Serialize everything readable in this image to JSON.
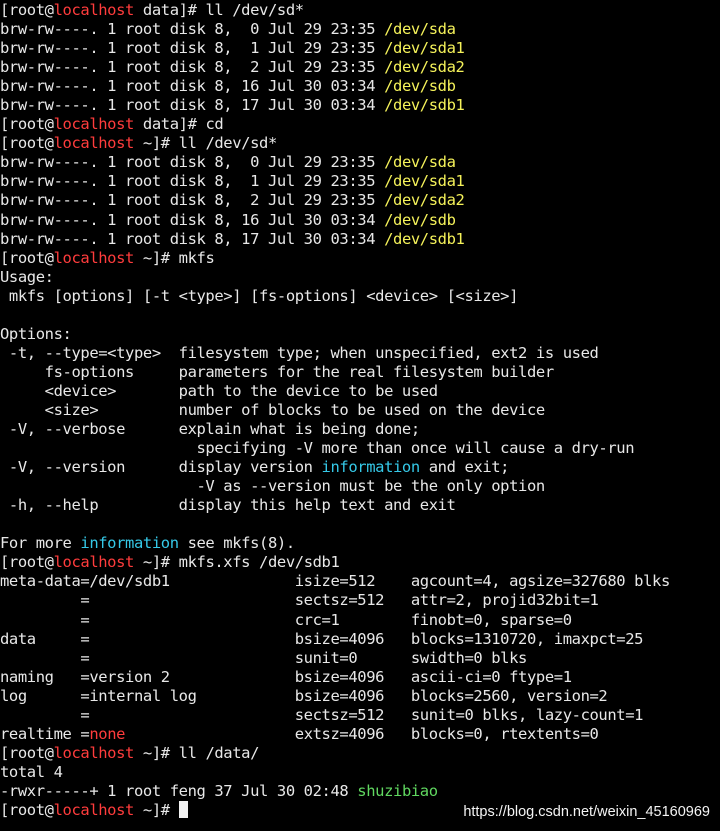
{
  "terminal": {
    "colors": {
      "background": "#000000",
      "text": "#e8e8e8",
      "hostname": "#ff3c3c",
      "device": "#f5f25a",
      "highlight": "#35c9e8",
      "executable": "#60d860",
      "cursor": "#f2f2f2"
    },
    "lines": [
      {
        "type": "prompt",
        "segments": [
          {
            "text": "[root@"
          },
          {
            "text": "localhost",
            "style": "host"
          },
          {
            "text": " data]# ll /dev/sd*"
          }
        ]
      },
      {
        "type": "output",
        "segments": [
          {
            "text": "brw-rw----. 1 root disk 8,  0 Jul 29 23:35 "
          },
          {
            "text": "/dev/sda",
            "style": "dev"
          }
        ]
      },
      {
        "type": "output",
        "segments": [
          {
            "text": "brw-rw----. 1 root disk 8,  1 Jul 29 23:35 "
          },
          {
            "text": "/dev/sda1",
            "style": "dev"
          }
        ]
      },
      {
        "type": "output",
        "segments": [
          {
            "text": "brw-rw----. 1 root disk 8,  2 Jul 29 23:35 "
          },
          {
            "text": "/dev/sda2",
            "style": "dev"
          }
        ]
      },
      {
        "type": "output",
        "segments": [
          {
            "text": "brw-rw----. 1 root disk 8, 16 Jul 30 03:34 "
          },
          {
            "text": "/dev/sdb",
            "style": "dev"
          }
        ]
      },
      {
        "type": "output",
        "segments": [
          {
            "text": "brw-rw----. 1 root disk 8, 17 Jul 30 03:34 "
          },
          {
            "text": "/dev/sdb1",
            "style": "dev"
          }
        ]
      },
      {
        "type": "prompt",
        "segments": [
          {
            "text": "[root@"
          },
          {
            "text": "localhost",
            "style": "host"
          },
          {
            "text": " data]# cd"
          }
        ]
      },
      {
        "type": "prompt",
        "segments": [
          {
            "text": "[root@"
          },
          {
            "text": "localhost",
            "style": "host"
          },
          {
            "text": " ~]# ll /dev/sd*"
          }
        ]
      },
      {
        "type": "output",
        "segments": [
          {
            "text": "brw-rw----. 1 root disk 8,  0 Jul 29 23:35 "
          },
          {
            "text": "/dev/sda",
            "style": "dev"
          }
        ]
      },
      {
        "type": "output",
        "segments": [
          {
            "text": "brw-rw----. 1 root disk 8,  1 Jul 29 23:35 "
          },
          {
            "text": "/dev/sda1",
            "style": "dev"
          }
        ]
      },
      {
        "type": "output",
        "segments": [
          {
            "text": "brw-rw----. 1 root disk 8,  2 Jul 29 23:35 "
          },
          {
            "text": "/dev/sda2",
            "style": "dev"
          }
        ]
      },
      {
        "type": "output",
        "segments": [
          {
            "text": "brw-rw----. 1 root disk 8, 16 Jul 30 03:34 "
          },
          {
            "text": "/dev/sdb",
            "style": "dev"
          }
        ]
      },
      {
        "type": "output",
        "segments": [
          {
            "text": "brw-rw----. 1 root disk 8, 17 Jul 30 03:34 "
          },
          {
            "text": "/dev/sdb1",
            "style": "dev"
          }
        ]
      },
      {
        "type": "prompt",
        "segments": [
          {
            "text": "[root@"
          },
          {
            "text": "localhost",
            "style": "host"
          },
          {
            "text": " ~]# mkfs"
          }
        ]
      },
      {
        "type": "output",
        "segments": [
          {
            "text": "Usage:"
          }
        ]
      },
      {
        "type": "output",
        "segments": [
          {
            "text": " mkfs [options] [-t <type>] [fs-options] <device> [<size>]"
          }
        ]
      },
      {
        "type": "output",
        "segments": [
          {
            "text": ""
          }
        ]
      },
      {
        "type": "output",
        "segments": [
          {
            "text": "Options:"
          }
        ]
      },
      {
        "type": "output",
        "segments": [
          {
            "text": " -t, --type=<type>  filesystem type; when unspecified, ext2 is used"
          }
        ]
      },
      {
        "type": "output",
        "segments": [
          {
            "text": "     fs-options     parameters for the real filesystem builder"
          }
        ]
      },
      {
        "type": "output",
        "segments": [
          {
            "text": "     <device>       path to the device to be used"
          }
        ]
      },
      {
        "type": "output",
        "segments": [
          {
            "text": "     <size>         number of blocks to be used on the device"
          }
        ]
      },
      {
        "type": "output",
        "segments": [
          {
            "text": " -V, --verbose      explain what is being done;"
          }
        ]
      },
      {
        "type": "output",
        "segments": [
          {
            "text": "                      specifying -V more than once will cause a dry-run"
          }
        ]
      },
      {
        "type": "output",
        "segments": [
          {
            "text": " -V, --version      display version "
          },
          {
            "text": "information",
            "style": "info"
          },
          {
            "text": " and exit;"
          }
        ]
      },
      {
        "type": "output",
        "segments": [
          {
            "text": "                      -V as --version must be the only option"
          }
        ]
      },
      {
        "type": "output",
        "segments": [
          {
            "text": " -h, --help         display this help text and exit"
          }
        ]
      },
      {
        "type": "output",
        "segments": [
          {
            "text": ""
          }
        ]
      },
      {
        "type": "output",
        "segments": [
          {
            "text": "For more "
          },
          {
            "text": "information",
            "style": "info"
          },
          {
            "text": " see mkfs(8)."
          }
        ]
      },
      {
        "type": "prompt",
        "segments": [
          {
            "text": "[root@"
          },
          {
            "text": "localhost",
            "style": "host"
          },
          {
            "text": " ~]# mkfs.xfs /dev/sdb1"
          }
        ]
      },
      {
        "type": "output",
        "segments": [
          {
            "text": "meta-data=/dev/sdb1              isize=512    agcount=4, agsize=327680 blks"
          }
        ]
      },
      {
        "type": "output",
        "segments": [
          {
            "text": "         =                       sectsz=512   attr=2, projid32bit=1"
          }
        ]
      },
      {
        "type": "output",
        "segments": [
          {
            "text": "         =                       crc=1        finobt=0, sparse=0"
          }
        ]
      },
      {
        "type": "output",
        "segments": [
          {
            "text": "data     =                       bsize=4096   blocks=1310720, imaxpct=25"
          }
        ]
      },
      {
        "type": "output",
        "segments": [
          {
            "text": "         =                       sunit=0      swidth=0 blks"
          }
        ]
      },
      {
        "type": "output",
        "segments": [
          {
            "text": "naming   =version 2              bsize=4096   ascii-ci=0 ftype=1"
          }
        ]
      },
      {
        "type": "output",
        "segments": [
          {
            "text": "log      =internal log           bsize=4096   blocks=2560, version=2"
          }
        ]
      },
      {
        "type": "output",
        "segments": [
          {
            "text": "         =                       sectsz=512   sunit=0 blks, lazy-count=1"
          }
        ]
      },
      {
        "type": "output",
        "segments": [
          {
            "text": "realtime ="
          },
          {
            "text": "none",
            "style": "host"
          },
          {
            "text": "                   extsz=4096   blocks=0, rtextents=0"
          }
        ]
      },
      {
        "type": "prompt",
        "segments": [
          {
            "text": "[root@"
          },
          {
            "text": "localhost",
            "style": "host"
          },
          {
            "text": " ~]# ll /data/"
          }
        ]
      },
      {
        "type": "output",
        "segments": [
          {
            "text": "total 4"
          }
        ]
      },
      {
        "type": "output",
        "segments": [
          {
            "text": "-rwxr-----+ 1 root feng 37 Jul 30 02:48 "
          },
          {
            "text": "shuzibiao",
            "style": "exec"
          }
        ]
      },
      {
        "type": "prompt",
        "segments": [
          {
            "text": "[root@"
          },
          {
            "text": "localhost",
            "style": "host"
          },
          {
            "text": " ~]# "
          }
        ],
        "cursor": true
      }
    ]
  },
  "watermark": {
    "text": "https://blog.csdn.net/weixin_45160969"
  }
}
